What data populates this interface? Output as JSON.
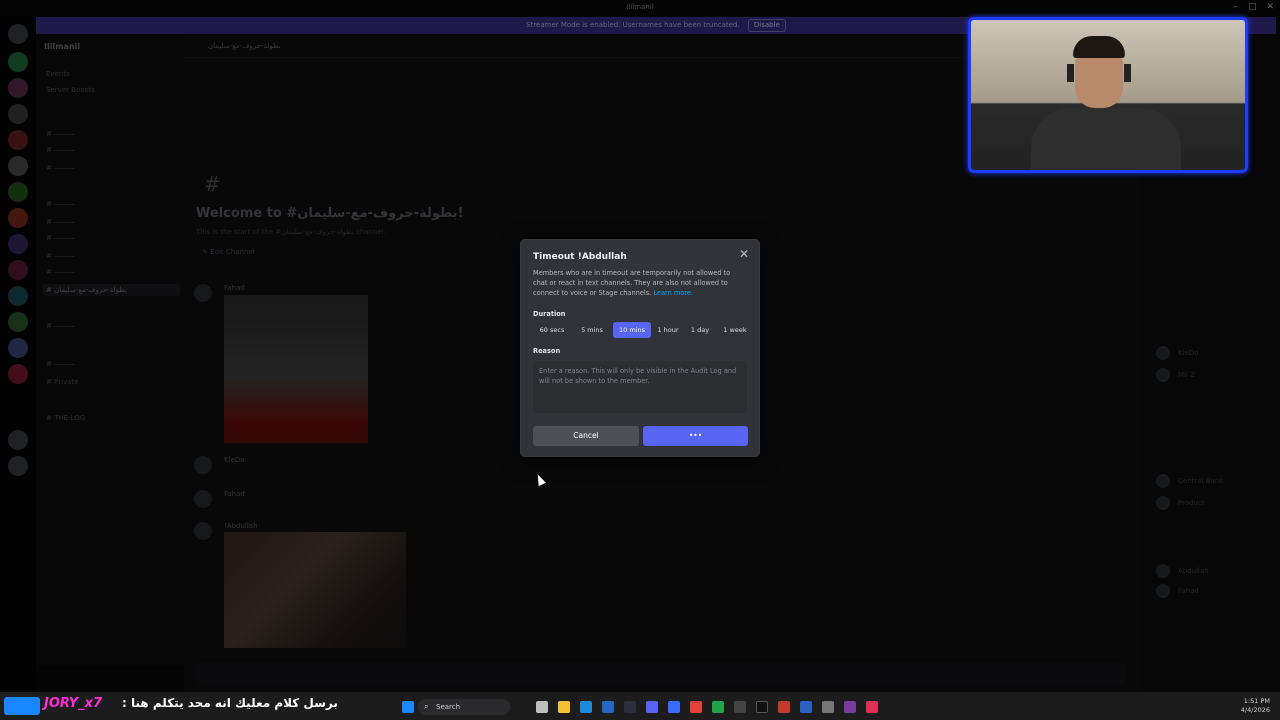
{
  "window": {
    "title": "Ililmanil"
  },
  "banner": {
    "text": "Streamer Mode is enabled. Usernames have been truncated.",
    "disable_label": "Disable"
  },
  "sidebar": {
    "guild_name": "Ililmanil",
    "items": [
      "Events",
      "Server Boosts"
    ],
    "active_channel": "بطولة-حروف-مع-سليمان",
    "private": "Private",
    "log": "THE-LOG"
  },
  "main": {
    "header_channel": "بطولة-حروف-مع-سليمان",
    "welcome_title": "Welcome to #بطولة-حروف-مع-سليمان!",
    "welcome_sub": "This is the start of the #بطولة-حروف-مع-سليمان channel.",
    "edit_channel": "Edit Channel",
    "messages": [
      {
        "author": "Fahad",
        "text": ""
      },
      {
        "author": "KleDo",
        "text": ""
      },
      {
        "author": "Fahad",
        "text": ""
      },
      {
        "author": "!Abdullah",
        "text": ""
      }
    ]
  },
  "members": {
    "names": [
      "Abdullah",
      "Fahad",
      "KleDo",
      "Mil Z",
      "Central Bank",
      "Product"
    ]
  },
  "modal": {
    "title": "Timeout !Abdullah",
    "description": "Members who are in timeout are temporarily not allowed to chat or react in text channels. They are also not allowed to connect to voice or Stage channels.",
    "learn_more": "Learn more.",
    "duration_label": "Duration",
    "durations": [
      "60 secs",
      "5 mins",
      "10 mins",
      "1 hour",
      "1 day",
      "1 week"
    ],
    "selected_duration": "10 mins",
    "reason_label": "Reason",
    "reason_placeholder": "Enter a reason. This will only be visible in the Audit Log and will not be shown to the member.",
    "cancel_label": "Cancel",
    "confirm_label": "•••"
  },
  "stream": {
    "name": "JORY_x7",
    "message": "برسل كلام معليك انه محد يتكلم هنا :"
  },
  "taskbar": {
    "search_label": "Search",
    "time": "1:51 PM",
    "date": "4/4/2026"
  },
  "colors": {
    "accent": "#5865f2",
    "banner": "#3a2f85",
    "webcam_border": "#1e3cff",
    "stream_name": "#ff2bd6"
  }
}
